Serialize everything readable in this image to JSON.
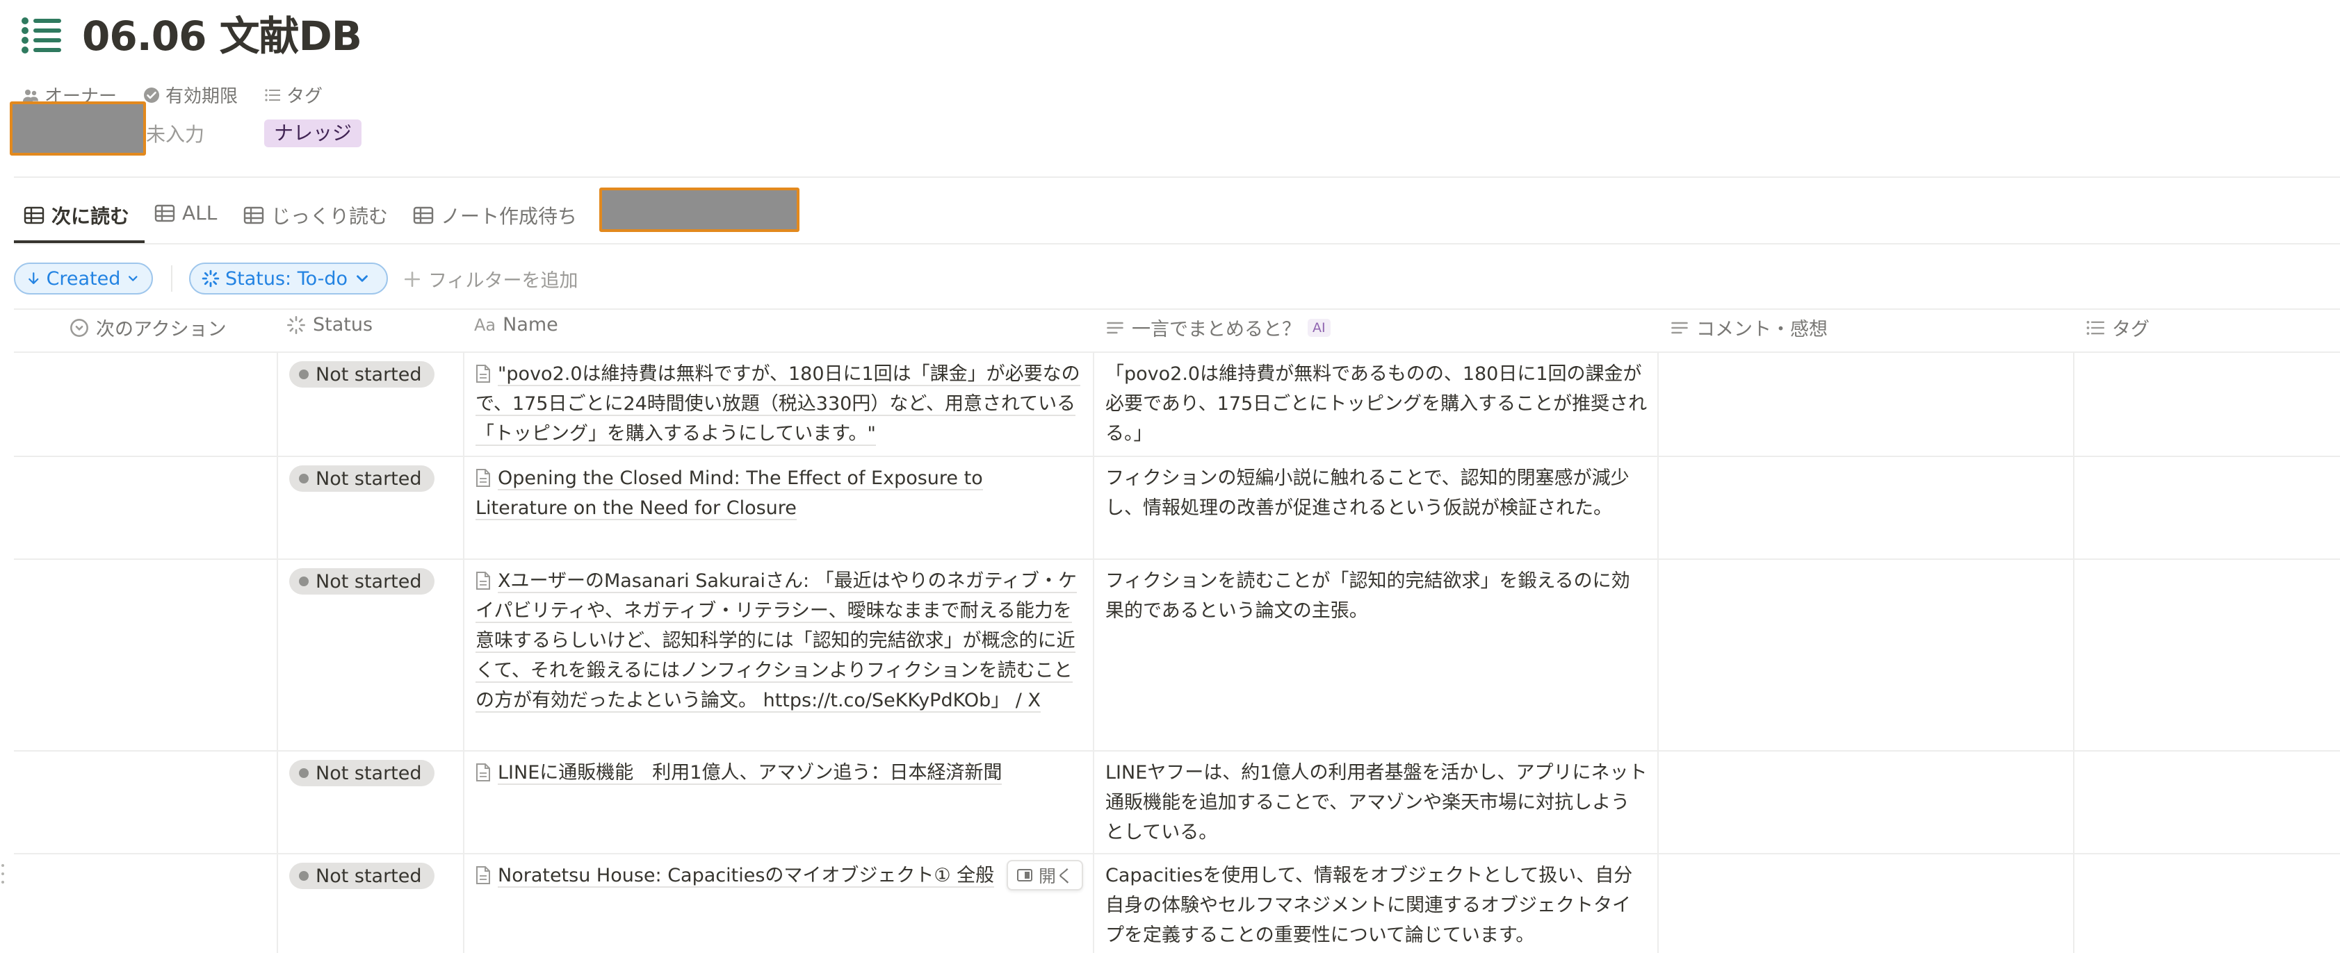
{
  "page": {
    "title": "06.06 文献DB"
  },
  "properties": {
    "owner_label": "オーナー",
    "expiry_label": "有効期限",
    "tag_label": "タグ",
    "expiry_value": "未入力",
    "tag_value": "ナレッジ"
  },
  "tabs": [
    {
      "label": "次に読む",
      "active": true
    },
    {
      "label": "ALL"
    },
    {
      "label": "じっくり読む"
    },
    {
      "label": "ノート作成待ち"
    }
  ],
  "filters": {
    "sort_label": "Created",
    "status_filter_label": "Status: To-do",
    "add_filter_label": "フィルターを追加"
  },
  "columns": {
    "next_action": "次のアクション",
    "status": "Status",
    "name": "Name",
    "summary": "一言でまとめると？",
    "ai_badge": "AI",
    "comment": "コメント・感想",
    "tag": "タグ"
  },
  "rows": [
    {
      "status": "Not started",
      "name": "\"povo2.0は維持費は無料ですが、180日に1回は「課金」が必要なので、175日ごとに24時間使い放題（税込330円）など、用意されている「トッピング」を購入するようにしています。\"",
      "summary": "「povo2.0は維持費が無料であるものの、180日に1回の課金が必要であり、175日ごとにトッピングを購入することが推奨される。」"
    },
    {
      "status": "Not started",
      "name": "Opening the Closed Mind: The Effect of Exposure to Literature on the Need for Closure",
      "summary": "フィクションの短編小説に触れることで、認知的閉塞感が減少し、情報処理の改善が促進されるという仮説が検証された。"
    },
    {
      "status": "Not started",
      "name": "XユーザーのMasanari Sakuraiさん: 「最近はやりのネガティブ・ケイパビリティや、ネガティブ・リテラシー、曖昧なままで耐える能力を意味するらしいけど、認知科学的には「認知的完結欲求」が概念的に近くて、それを鍛えるにはノンフィクションよりフィクションを読むことの方が有効だったよという論文。 https://t.co/SeKKyPdKOb」 / X",
      "summary": "フィクションを読むことが「認知的完結欲求」を鍛えるのに効果的であるという論文の主張。"
    },
    {
      "status": "Not started",
      "name": "LINEに通販機能　利用1億人、アマゾン追う：日本経済新聞",
      "summary": "LINEヤフーは、約1億人の利用者基盤を活かし、アプリにネット通販機能を追加することで、アマゾンや楽天市場に対抗しようとしている。"
    },
    {
      "status": "Not started",
      "name": "Noratetsu House: Capacitiesのマイオブジェクト① 全般",
      "summary": "Capacitiesを使用して、情報をオブジェクトとして扱い、自分自身の体験やセルフマネジメントに関連するオブジェクトタイプを定義することの重要性について論じています。"
    }
  ],
  "hover": {
    "open_label": "開く"
  },
  "colors": {
    "accent": "#2383e2",
    "title_icon": "#2f7a5f",
    "redaction_border": "#e2891e"
  }
}
